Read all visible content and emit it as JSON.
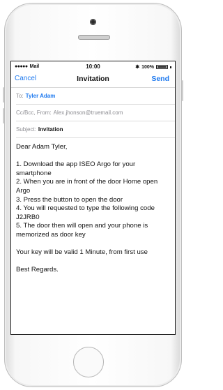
{
  "status_bar": {
    "carrier": "Mail",
    "time": "10:00",
    "bluetooth": "✱",
    "battery": "100%"
  },
  "nav": {
    "cancel": "Cancel",
    "title": "Invitation",
    "send": "Send"
  },
  "compose": {
    "to_label": "To:",
    "to_value": "Tyler Adam",
    "ccbcc_label": "Cc/Bcc, From:",
    "from_value": "Alex.jhonson@truemail.com",
    "subject_label": "Subject:",
    "subject_value": "Invitation"
  },
  "body": {
    "greeting": "Dear Adam Tyler,",
    "steps": [
      "1. Download the app ISEO Argo for your smartphone",
      "2. When you are in front of the door Home open Argo",
      "3. Press the button to open the door",
      "4. You will requested to type the following code J2JRB0",
      "5. The door then will open and your phone is memorized as door key"
    ],
    "validity": "Your key will be valid 1 Minute, from first use",
    "signoff": "Best Regards."
  },
  "colors": {
    "accent": "#1f7aef",
    "label_gray": "#8e8e93"
  }
}
